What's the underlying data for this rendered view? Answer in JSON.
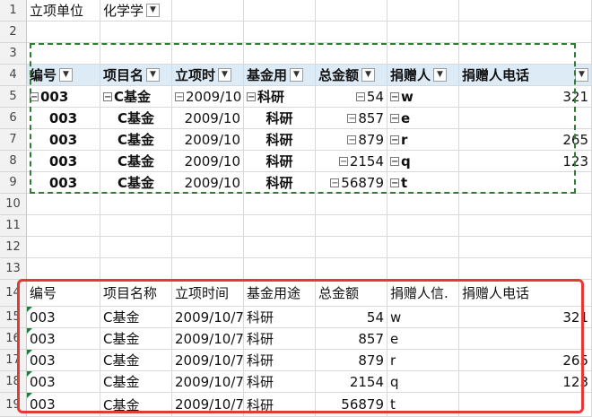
{
  "filter": {
    "label": "立项单位",
    "value": "化学学",
    "icon": "funnel-icon"
  },
  "row_numbers": [
    "1",
    "2",
    "3",
    "4",
    "5",
    "6",
    "7",
    "8",
    "9",
    "10",
    "11",
    "12",
    "13",
    "14",
    "15",
    "16",
    "17",
    "18",
    "19"
  ],
  "pivot": {
    "headers": [
      "编号",
      "项目名",
      "立项时",
      "基金用",
      "总金额",
      "捐赠人",
      "捐赠人电话"
    ],
    "rows": [
      [
        "003",
        "C基金",
        "2009/10",
        "科研",
        "54",
        "w",
        "321"
      ],
      [
        "003",
        "C基金",
        "2009/10",
        "科研",
        "857",
        "e",
        ""
      ],
      [
        "003",
        "C基金",
        "2009/10",
        "科研",
        "879",
        "r",
        "265"
      ],
      [
        "003",
        "C基金",
        "2009/10",
        "科研",
        "2154",
        "q",
        "123"
      ],
      [
        "003",
        "C基金",
        "2009/10",
        "科研",
        "56879",
        "t",
        ""
      ]
    ]
  },
  "table": {
    "headers": [
      "编号",
      "项目名称",
      "立项时间",
      "基金用途",
      "总金额",
      "捐赠人信.",
      "捐赠人电话"
    ],
    "rows": [
      [
        "003",
        "C基金",
        "2009/10/7",
        "科研",
        "54",
        "w",
        "321"
      ],
      [
        "003",
        "C基金",
        "2009/10/7",
        "科研",
        "857",
        "e",
        ""
      ],
      [
        "003",
        "C基金",
        "2009/10/7",
        "科研",
        "879",
        "r",
        "265"
      ],
      [
        "003",
        "C基金",
        "2009/10/7",
        "科研",
        "2154",
        "q",
        "123"
      ],
      [
        "003",
        "C基金",
        "2009/10/7",
        "科研",
        "56879",
        "t",
        ""
      ]
    ]
  },
  "colors": {
    "dashed_selection": "#2e7d32",
    "highlight_box": "#e53935",
    "pivot_header_fill": "#ddebf7"
  }
}
